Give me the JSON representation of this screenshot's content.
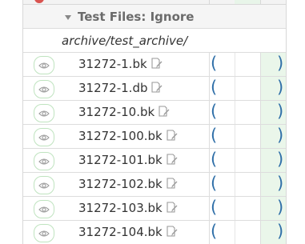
{
  "group": {
    "title": "Test Files: Ignore"
  },
  "path": "archive/test_archive/",
  "rows": [
    {
      "name": "31272-1.bk"
    },
    {
      "name": "31272-1.db"
    },
    {
      "name": "31272-10.bk"
    },
    {
      "name": "31272-100.bk"
    },
    {
      "name": "31272-101.bk"
    },
    {
      "name": "31272-102.bk"
    },
    {
      "name": "31272-103.bk"
    },
    {
      "name": "31272-104.bk"
    }
  ],
  "paren_open": "(",
  "paren_close": ")",
  "colors": {
    "eye_border": "#bfe3bf",
    "paren": "#2f6fa8",
    "status_col": "#eaf6ea"
  }
}
